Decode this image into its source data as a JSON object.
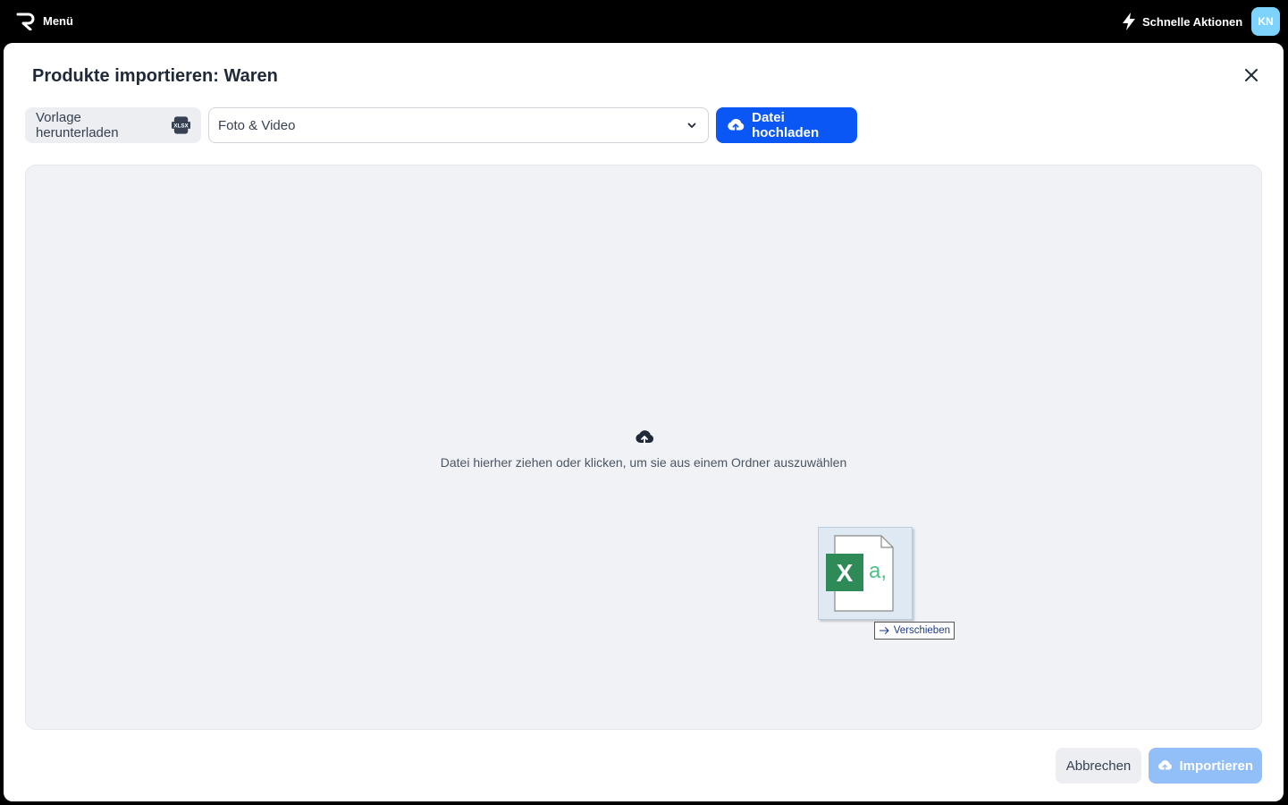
{
  "topbar": {
    "menu_label": "Menü",
    "quick_actions_label": "Schnelle Aktionen",
    "avatar_initials": "KN"
  },
  "modal": {
    "title": "Produkte importieren: Waren",
    "template_button_label": "Vorlage herunterladen",
    "template_badge": "XLSX",
    "category_select": {
      "selected": "Foto & Video"
    },
    "upload_button_label": "Datei hochladen",
    "dropzone_text": "Datei hierher ziehen oder klicken, um sie aus einem Ordner auszuwählen",
    "drag_preview": {
      "tooltip_label": "Verschieben",
      "file_glyph": "X",
      "file_subglyph": "a,"
    },
    "cancel_button_label": "Abbrechen",
    "import_button_label": "Importieren"
  },
  "colors": {
    "topbar_bg": "#000000",
    "primary": "#0b57f5",
    "primary_disabled": "#93bff8",
    "avatar_bg": "#7dd3fc",
    "dropzone_bg": "#f0f2f6",
    "excel_green": "#2e8b57"
  },
  "icons": [
    "logo-icon",
    "lightning-icon",
    "close-icon",
    "xlsx-icon",
    "chevron-down-icon",
    "cloud-upload-icon",
    "excel-file-icon",
    "arrow-right-icon"
  ]
}
